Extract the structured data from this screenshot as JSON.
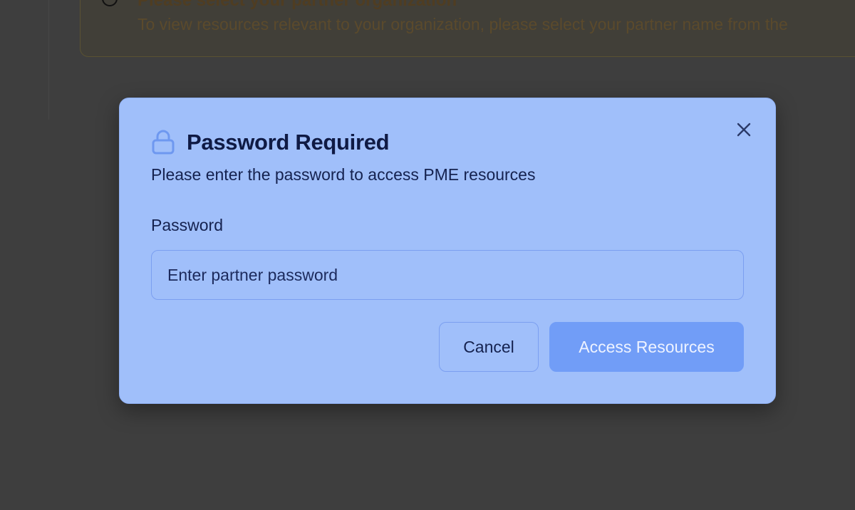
{
  "background": {
    "notice_title": "Please select your partner organization",
    "notice_text": "To view resources relevant to your organization, please select your partner name from the"
  },
  "modal": {
    "title": "Password Required",
    "subtitle": "Please enter the password to access PME resources",
    "password_label": "Password",
    "password_placeholder": "Enter partner password",
    "password_value": "",
    "cancel_label": "Cancel",
    "access_label": "Access Resources",
    "icons": {
      "lock": "lock-icon",
      "close": "close-icon"
    }
  },
  "colors": {
    "modal_bg": "#a0bffa",
    "primary_button": "#719df7",
    "title_text": "#0f1a44",
    "lock_icon": "#6e98f0",
    "overlay": "#3e3e3e"
  }
}
